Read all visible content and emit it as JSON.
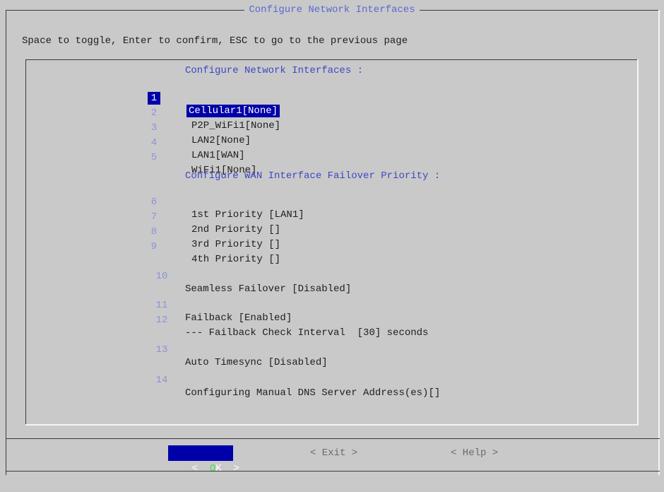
{
  "dialog": {
    "title": "Configure Network Interfaces",
    "hint": "Space to toggle, Enter to confirm, ESC to go to the previous page"
  },
  "menu": {
    "section1_title": "Configure Network Interfaces :",
    "section2_title": "Configure WAN Interface Failover Priority :",
    "items": [
      {
        "num": "1",
        "label": "Cellular1[None]"
      },
      {
        "num": "2",
        "label": "P2P_WiFi1[None]"
      },
      {
        "num": "3",
        "label": "LAN2[None]"
      },
      {
        "num": "4",
        "label": "LAN1[WAN]"
      },
      {
        "num": "5",
        "label": "WiFi1[None]"
      },
      {
        "num": "6",
        "label": "1st Priority [LAN1]"
      },
      {
        "num": "7",
        "label": "2nd Priority []"
      },
      {
        "num": "8",
        "label": "3rd Priority []"
      },
      {
        "num": "9",
        "label": "4th Priority []"
      },
      {
        "num": "10",
        "label": "Seamless Failover [Disabled]"
      },
      {
        "num": "11",
        "label": "Failback [Enabled]"
      },
      {
        "num": "12",
        "label": "--- Failback Check Interval  [30] seconds"
      },
      {
        "num": "13",
        "label": "Auto Timesync [Disabled]"
      },
      {
        "num": "14",
        "label": "Configuring Manual DNS Server Address(es)[]"
      }
    ]
  },
  "buttons": {
    "ok_left": "<  ",
    "ok_hot": "O",
    "ok_rest": "K  >",
    "exit": "< Exit >",
    "help": "< Help >"
  }
}
